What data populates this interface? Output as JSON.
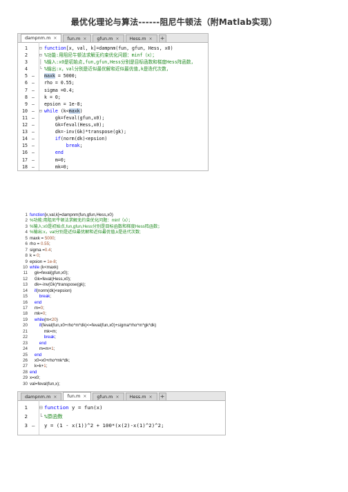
{
  "doc_title": "最优化理论与算法------阻尼牛顿法（附Matlab实现）",
  "editor1": {
    "tabs": [
      {
        "label": "dampnm.m",
        "active": true
      },
      {
        "label": "fun.m",
        "active": false
      },
      {
        "label": "gfun.m",
        "active": false
      },
      {
        "label": "Hess.m",
        "active": false
      }
    ],
    "add_label": "+",
    "lines": [
      {
        "n": "1",
        "dash": "",
        "fold": "⊟",
        "text": "function[x, val, k]=dampnm(fun, gfun, Hess, x0)",
        "cls": "kwline"
      },
      {
        "n": "2",
        "dash": "",
        "fold": "⊟",
        "text": "%功能:用阻尼牛顿法求解无约束优化问题：minf（x）；",
        "cls": "cm"
      },
      {
        "n": "3",
        "dash": "",
        "fold": "│",
        "text": "%输入:x0是初始点,fun,gfun,Hess分别是目标函数和梯度Hess阵函数，",
        "cls": "cm"
      },
      {
        "n": "4",
        "dash": "",
        "fold": "└",
        "text": "%输出:x，val分别是近似最优解和近似最优值,k是迭代次数，",
        "cls": "cm"
      },
      {
        "n": "5",
        "dash": "—",
        "fold": "",
        "text": "maxk = 5000;",
        "cls": "maxk"
      },
      {
        "n": "6",
        "dash": "—",
        "fold": "",
        "text": "rho = 0.55;",
        "cls": ""
      },
      {
        "n": "7",
        "dash": "—",
        "fold": "",
        "text": "sigma =0.4;",
        "cls": ""
      },
      {
        "n": "8",
        "dash": "—",
        "fold": "",
        "text": "k = 0;",
        "cls": ""
      },
      {
        "n": "9",
        "dash": "—",
        "fold": "",
        "text": "epsion = 1e-8;",
        "cls": ""
      },
      {
        "n": "10",
        "dash": "—",
        "fold": "⊟",
        "text": "while (k<maxk)",
        "cls": "while"
      },
      {
        "n": "11",
        "dash": "—",
        "fold": "",
        "text": "    gk=feval(gfun,x0);",
        "cls": ""
      },
      {
        "n": "12",
        "dash": "—",
        "fold": "",
        "text": "    Gk=feval(Hess,x0);",
        "cls": ""
      },
      {
        "n": "13",
        "dash": "—",
        "fold": "",
        "text": "    dk=-inv(Gk)*transpose(gk);",
        "cls": ""
      },
      {
        "n": "14",
        "dash": "—",
        "fold": "",
        "text": "    if(norm(dk)<epsion)",
        "cls": "if"
      },
      {
        "n": "15",
        "dash": "—",
        "fold": "",
        "text": "        break;",
        "cls": "kw"
      },
      {
        "n": "16",
        "dash": "—",
        "fold": "",
        "text": "    end",
        "cls": "kw"
      },
      {
        "n": "17",
        "dash": "—",
        "fold": "",
        "text": "    m=0;",
        "cls": ""
      },
      {
        "n": "18",
        "dash": "—",
        "fold": "",
        "text": "    mk=0;",
        "cls": ""
      }
    ]
  },
  "listing": [
    {
      "n": "1",
      "text": "function[x,val,k]=dampnm(fun,gfun,Hess,x0)"
    },
    {
      "n": "2",
      "text": "%功能:用阻尼牛顿法求解无约束优化问题：minf（x）；"
    },
    {
      "n": "3",
      "text": "%输入:x0是初始点,fun,gfun,Hess分别是目标函数和梯度Hess阵函数；"
    },
    {
      "n": "4",
      "text": "%输出:x，val分别是近似最优解和近似最优值,k是迭代次数;"
    },
    {
      "n": "5",
      "text": "maxk = 5000;"
    },
    {
      "n": "6",
      "text": "rho = 0.55;"
    },
    {
      "n": "7",
      "text": "sigma =0.4;"
    },
    {
      "n": "8",
      "text": "k = 0;"
    },
    {
      "n": "9",
      "text": "epsion = 1e-8;"
    },
    {
      "n": "10",
      "text": "while (k<maxk)"
    },
    {
      "n": "11",
      "text": "    gk=feval(gfun,x0);"
    },
    {
      "n": "12",
      "text": "    Gk=feval(Hess,x0);"
    },
    {
      "n": "13",
      "text": "    dk=-inv(Gk)*transpose(gk);"
    },
    {
      "n": "14",
      "text": "    if(norm(dk)<epsion)"
    },
    {
      "n": "15",
      "text": "        break;"
    },
    {
      "n": "16",
      "text": "    end"
    },
    {
      "n": "17",
      "text": "    m=0;"
    },
    {
      "n": "18",
      "text": "    mk=0;"
    },
    {
      "n": "19",
      "text": "    while(m<20)"
    },
    {
      "n": "20",
      "text": "        if(feval(fun,x0+rho^m*dk)<=feval(fun,x0)+sigma*rho^m*gk*dk)"
    },
    {
      "n": "21",
      "text": "            mk=m;"
    },
    {
      "n": "22",
      "text": "            break;"
    },
    {
      "n": "23",
      "text": "        end"
    },
    {
      "n": "24",
      "text": "        m=m+1;"
    },
    {
      "n": "25",
      "text": "    end"
    },
    {
      "n": "26",
      "text": "    x0=x0+rho^mk*dk;"
    },
    {
      "n": "27",
      "text": "    k=k+1;"
    },
    {
      "n": "28",
      "text": "end"
    },
    {
      "n": "29",
      "text": "x=x0;"
    },
    {
      "n": "30",
      "text": "val=feval(fun,x);"
    }
  ],
  "editor2": {
    "tabs": [
      {
        "label": "dampnm.m",
        "active": false
      },
      {
        "label": "fun.m",
        "active": true
      },
      {
        "label": "gfun.m",
        "active": false
      },
      {
        "label": "Hess.m",
        "active": false
      }
    ],
    "add_label": "+",
    "lines": [
      {
        "n": "1",
        "dash": "",
        "fold": "⊟",
        "text": "function y = fun(x)",
        "cls": "fn"
      },
      {
        "n": "2",
        "dash": "",
        "fold": "└",
        "text": "%原函数",
        "cls": "cm"
      },
      {
        "n": "3",
        "dash": "—",
        "fold": "",
        "text": "y = (1 - x(1))^2 + 100*(x(2)-x(1)^2)^2;",
        "cls": ""
      }
    ]
  }
}
